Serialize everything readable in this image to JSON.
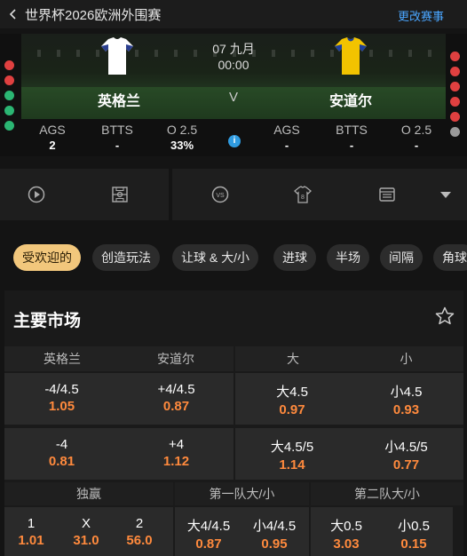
{
  "header": {
    "back_icon": "chevron-left-icon",
    "title": "世界杯2026欧洲外围赛",
    "change_label": "更改赛事"
  },
  "match": {
    "date": "07 九月",
    "time": "00:00",
    "vs": "V",
    "home": {
      "name": "英格兰",
      "shirt_color": "#ffffff",
      "shirt_accent": "#2b3f8f"
    },
    "away": {
      "name": "安道尔",
      "shirt_color": "#f2c300",
      "shirt_accent": "#1d3f9a"
    },
    "left_form_colors": [
      "#e04040",
      "#e04040",
      "#2bb673",
      "#2bb673",
      "#2bb673",
      "#2bb673"
    ],
    "right_form_colors": [
      "#e04040",
      "#e04040",
      "#e04040",
      "#e04040",
      "#e04040",
      "#9a9a9a"
    ],
    "stats_home": [
      {
        "label": "AGS",
        "value": "2"
      },
      {
        "label": "BTTS",
        "value": "-"
      },
      {
        "label": "O 2.5",
        "value": "33%"
      }
    ],
    "stats_away": [
      {
        "label": "AGS",
        "value": "-"
      },
      {
        "label": "BTTS",
        "value": "-"
      },
      {
        "label": "O 2.5",
        "value": "-"
      }
    ],
    "info_icon": "info-icon"
  },
  "icons": [
    "play-icon",
    "pitch-icon",
    "vs-icon",
    "jersey-icon",
    "scoreboard-icon",
    "dropdown-icon"
  ],
  "tabs": [
    "受欢迎的",
    "创造玩法",
    "让球 & 大/小",
    "进球",
    "半场",
    "间隔",
    "角球"
  ],
  "market": {
    "title": "主要市场",
    "star_icon": "star-icon",
    "headers": [
      "英格兰",
      "安道尔",
      "大",
      "小"
    ],
    "rows": [
      {
        "home": {
          "line": "-4/4.5",
          "odds": "1.05"
        },
        "away": {
          "line": "+4/4.5",
          "odds": "0.87"
        },
        "over": {
          "line": "大4.5",
          "odds": "0.97"
        },
        "under": {
          "line": "小4.5",
          "odds": "0.93"
        }
      },
      {
        "home": {
          "line": "-4",
          "odds": "0.81"
        },
        "away": {
          "line": "+4",
          "odds": "1.12"
        },
        "over": {
          "line": "大4.5/5",
          "odds": "1.14"
        },
        "under": {
          "line": "小4.5/5",
          "odds": "0.77"
        }
      }
    ],
    "section_headers": [
      "独赢",
      "第一队大/小",
      "第二队大/小"
    ],
    "winner": [
      {
        "label": "1",
        "odds": "1.01"
      },
      {
        "label": "X",
        "odds": "31.0"
      },
      {
        "label": "2",
        "odds": "56.0"
      }
    ],
    "team1_ou": [
      {
        "label": "大4/4.5",
        "odds": "0.87"
      },
      {
        "label": "小4/4.5",
        "odds": "0.95"
      }
    ],
    "team2_ou": [
      {
        "label": "大0.5",
        "odds": "3.03"
      },
      {
        "label": "小0.5",
        "odds": "0.15"
      }
    ]
  }
}
